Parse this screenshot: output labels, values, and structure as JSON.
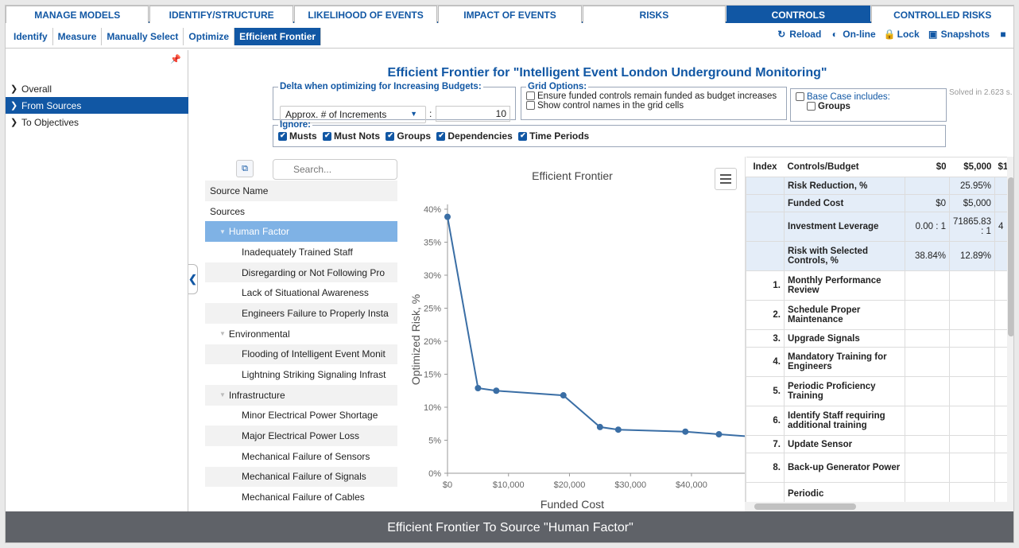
{
  "top_tabs": [
    "MANAGE MODELS",
    "IDENTIFY/STRUCTURE",
    "LIKELIHOOD OF EVENTS",
    "IMPACT OF EVENTS",
    "RISKS",
    "CONTROLS",
    "CONTROLLED RISKS"
  ],
  "sub_tabs": [
    "Identify",
    "Measure",
    "Manually Select",
    "Optimize",
    "Efficient Frontier"
  ],
  "toolbar": {
    "reload": "Reload",
    "online": "On-line",
    "lock": "Lock",
    "snapshots": "Snapshots"
  },
  "left_nav": [
    "Overall",
    "From Sources",
    "To Objectives"
  ],
  "page_title": "Efficient Frontier for \"Intelligent Event London Underground Monitoring\"",
  "delta": {
    "legend": "Delta when optimizing for Increasing Budgets:",
    "mode": "Approx. # of Increments",
    "value": "10"
  },
  "grid": {
    "legend": "Grid Options:",
    "opt1": "Ensure funded controls remain funded as budget increases",
    "opt2": "Show control names in the grid cells"
  },
  "base": {
    "label": "Base Case includes:",
    "groups": "Groups"
  },
  "solved": "Solved in 2.623 s.",
  "ignore": {
    "legend": "Ignore:",
    "items": [
      "Musts",
      "Must Nots",
      "Groups",
      "Dependencies",
      "Time Periods"
    ]
  },
  "tree": {
    "search_placeholder": "Search...",
    "header": "Source Name",
    "rows": [
      "Sources",
      "Human Factor",
      "Inadequately Trained Staff",
      "Disregarding or Not Following Pro",
      "Lack of Situational Awareness",
      "Engineers Failure to Properly Insta",
      "Environmental",
      "Flooding of Intelligent Event Monit",
      "Lightning Striking Signaling Infrast",
      "Infrastructure",
      "Minor Electrical Power Shortage",
      "Major Electrical Power Loss",
      "Mechanical Failure of Sensors",
      "Mechanical Failure of Signals",
      "Mechanical Failure of Cables"
    ]
  },
  "chart_data": {
    "type": "line",
    "title": "Efficient Frontier",
    "xlabel": "Funded Cost",
    "ylabel": "Optimized Risk, %",
    "x_ticks": [
      "$0",
      "$10,000",
      "$20,000",
      "$30,000",
      "$40,000"
    ],
    "y_ticks": [
      "0%",
      "5%",
      "10%",
      "15%",
      "20%",
      "25%",
      "30%",
      "35%",
      "40%"
    ],
    "xlim": [
      0,
      49000
    ],
    "ylim": [
      0,
      40
    ],
    "series": [
      {
        "x": [
          0,
          5000,
          8000,
          19000,
          25000,
          28000,
          39000,
          44500,
          49000
        ],
        "y": [
          38.84,
          12.89,
          12.5,
          11.8,
          7.0,
          6.6,
          6.3,
          5.9,
          5.6
        ]
      }
    ]
  },
  "table": {
    "headers": [
      "Index",
      "Controls/Budget",
      "$0",
      "$5,000",
      "$1"
    ],
    "summary": [
      {
        "name": "Risk Reduction, %",
        "v0": "",
        "v1": "25.95%"
      },
      {
        "name": "Funded Cost",
        "v0": "$0",
        "v1": "$5,000"
      },
      {
        "name": "Investment Leverage",
        "v0": "0.00 : 1",
        "v1": "71865.83 : 1",
        "v2": "4"
      },
      {
        "name": "Risk with Selected Controls, %",
        "v0": "38.84%",
        "v1": "12.89%"
      }
    ],
    "controls": [
      {
        "idx": "1.",
        "name": "Monthly Performance Review"
      },
      {
        "idx": "2.",
        "name": "Schedule Proper Maintenance"
      },
      {
        "idx": "3.",
        "name": "Upgrade Signals"
      },
      {
        "idx": "4.",
        "name": "Mandatory Training for Engineers"
      },
      {
        "idx": "5.",
        "name": "Periodic Proficiency Training"
      },
      {
        "idx": "6.",
        "name": "Identify Staff requiring additional training"
      },
      {
        "idx": "7.",
        "name": "Update Sensor"
      },
      {
        "idx": "8.",
        "name": "Back-up Generator Power"
      },
      {
        "idx": "",
        "name": "Periodic"
      }
    ]
  },
  "caption": "Efficient Frontier To Source \"Human Factor\""
}
